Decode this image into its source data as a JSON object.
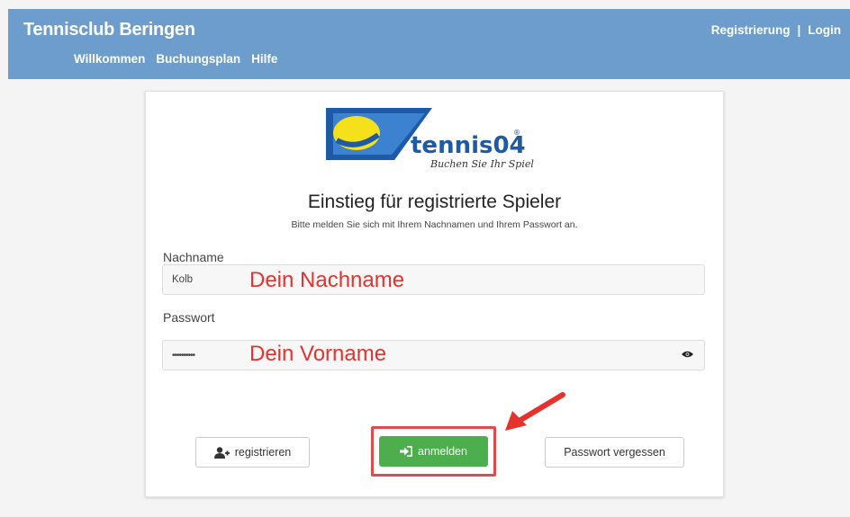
{
  "header": {
    "brand": "Tennisclub Beringen",
    "nav": [
      "Willkommen",
      "Buchungsplan",
      "Hilfe"
    ],
    "register_link": "Registrierung",
    "separator": "|",
    "login_link": "Login"
  },
  "logo": {
    "name": "tennis04",
    "tagline": "Buchen Sie Ihr Spiel",
    "registered": "®"
  },
  "login": {
    "title": "Einstieg für registrierte Spieler",
    "subtitle": "Bitte melden Sie sich mit Ihrem Nachnamen und Ihrem Passwort an.",
    "lastname_label": "Nachname",
    "lastname_value": "Kolb",
    "password_label": "Passwort",
    "password_value": "••••••••••"
  },
  "annotations": {
    "lastname_hint": "Dein Nachname",
    "password_hint": "Dein Vorname"
  },
  "buttons": {
    "register": "registrieren",
    "login": "anmelden",
    "forgot": "Passwort vergessen"
  },
  "colors": {
    "header_bg": "#6d9dcc",
    "login_button": "#4cae4c",
    "annotation": "#e5322d"
  }
}
